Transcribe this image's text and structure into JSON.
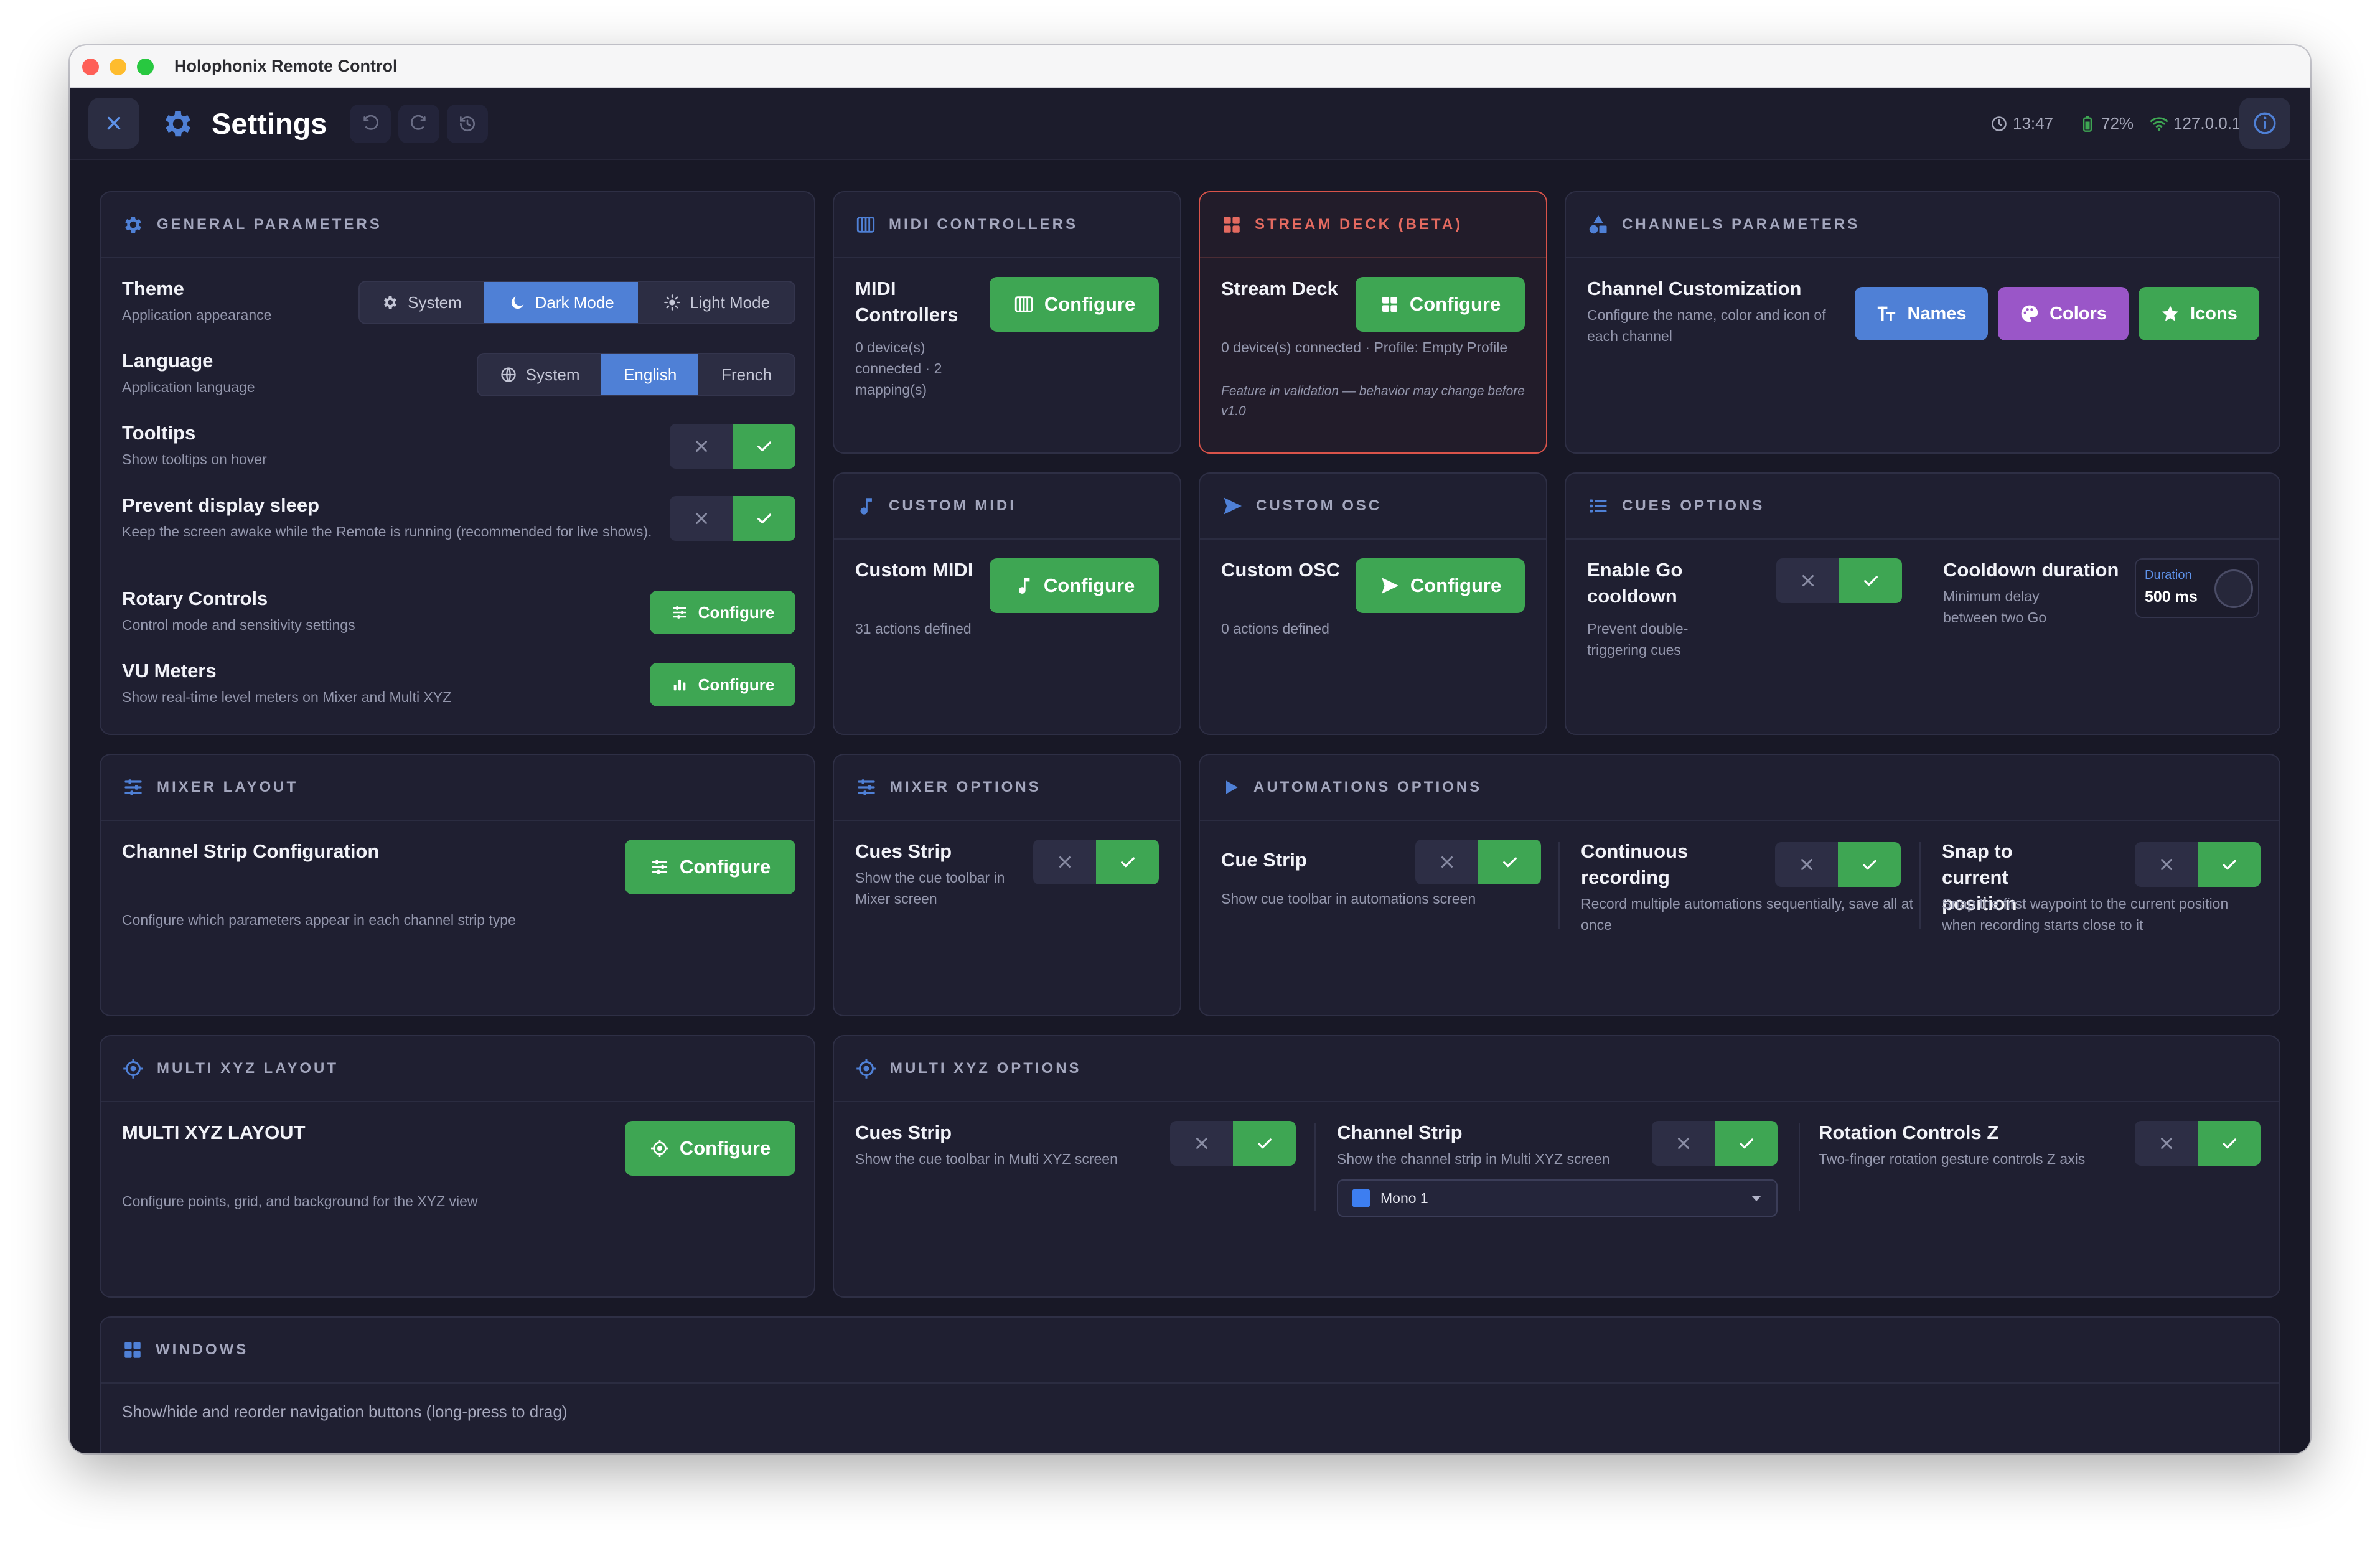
{
  "window": {
    "title": "Holophonix Remote Control"
  },
  "header": {
    "title": "Settings",
    "time": "13:47",
    "battery": "72%",
    "ip": "127.0.0.1"
  },
  "general": {
    "title": "GENERAL PARAMETERS",
    "theme": {
      "label": "Theme",
      "desc": "Application appearance",
      "options": [
        "System",
        "Dark Mode",
        "Light Mode"
      ],
      "selected": "Dark Mode"
    },
    "language": {
      "label": "Language",
      "desc": "Application language",
      "options": [
        "System",
        "English",
        "French"
      ],
      "selected": "English"
    },
    "tooltips": {
      "label": "Tooltips",
      "desc": "Show tooltips on hover",
      "enabled": true
    },
    "sleep": {
      "label": "Prevent display sleep",
      "desc": "Keep the screen awake while the Remote is running (recommended for live shows).",
      "enabled": true
    },
    "rotary": {
      "label": "Rotary Controls",
      "desc": "Control mode and sensitivity settings",
      "button": "Configure"
    },
    "vu": {
      "label": "VU Meters",
      "desc": "Show real-time level meters on Mixer and Multi XYZ",
      "button": "Configure"
    }
  },
  "midi": {
    "title": "MIDI CONTROLLERS",
    "label": "MIDI Controllers",
    "desc": "0 device(s) connected · 2 mapping(s)",
    "button": "Configure"
  },
  "streamdeck": {
    "title": "STREAM DECK (BETA)",
    "label": "Stream Deck",
    "desc": "0 device(s) connected · Profile: Empty Profile",
    "note": "Feature in validation — behavior may change before v1.0",
    "button": "Configure"
  },
  "channels": {
    "title": "CHANNELS PARAMETERS",
    "label": "Channel Customization",
    "desc": "Configure the name, color and icon of each channel",
    "buttons": {
      "names": "Names",
      "colors": "Colors",
      "icons": "Icons"
    }
  },
  "custom_midi": {
    "title": "CUSTOM MIDI",
    "label": "Custom MIDI",
    "desc": "31 actions defined",
    "button": "Configure"
  },
  "custom_osc": {
    "title": "CUSTOM OSC",
    "label": "Custom OSC",
    "desc": "0 actions defined",
    "button": "Configure"
  },
  "cues": {
    "title": "CUES OPTIONS",
    "go": {
      "label": "Enable Go cooldown",
      "desc": "Prevent double-triggering cues",
      "enabled": true
    },
    "cooldown": {
      "label": "Cooldown duration",
      "desc": "Minimum delay between two Go",
      "dial_label": "Duration",
      "dial_value": "500 ms"
    }
  },
  "mixer_layout": {
    "title": "MIXER LAYOUT",
    "label": "Channel Strip Configuration",
    "desc": "Configure which parameters appear in each channel strip type",
    "button": "Configure"
  },
  "mixer_options": {
    "title": "MIXER OPTIONS",
    "label": "Cues Strip",
    "desc": "Show the cue toolbar in Mixer screen",
    "enabled": true
  },
  "automations": {
    "title": "AUTOMATIONS OPTIONS",
    "cue_strip": {
      "label": "Cue Strip",
      "desc": "Show cue toolbar in automations screen",
      "enabled": true
    },
    "continuous": {
      "label": "Continuous recording",
      "desc": "Record multiple automations sequentially, save all at once",
      "enabled": true
    },
    "snap": {
      "label": "Snap to current position",
      "desc": "Snap the first waypoint to the current position when recording starts close to it",
      "enabled": true
    }
  },
  "xyz_layout": {
    "title": "MULTI XYZ LAYOUT",
    "label": "MULTI XYZ LAYOUT",
    "desc": "Configure points, grid, and background for the XYZ view",
    "button": "Configure"
  },
  "xyz_options": {
    "title": "MULTI XYZ OPTIONS",
    "cues": {
      "label": "Cues Strip",
      "desc": "Show the cue toolbar in Multi XYZ screen",
      "enabled": true
    },
    "channel": {
      "label": "Channel Strip",
      "desc": "Show the channel strip in Multi XYZ screen",
      "enabled": true,
      "select_value": "Mono 1",
      "select_color": "#3d7ef0"
    },
    "rotation": {
      "label": "Rotation Controls Z",
      "desc": "Two-finger rotation gesture controls Z axis",
      "enabled": true
    }
  },
  "windows": {
    "title": "WINDOWS",
    "desc": "Show/hide and reorder navigation buttons (long-press to drag)",
    "tab_colors": [
      "#c0444a",
      "#8a54b6",
      "#3f9a62",
      "#4f7ed2",
      "#d5783c",
      "#4aa2d8"
    ]
  },
  "colors": {
    "accent_green": "#3ea653",
    "accent_blue": "#4f80d6",
    "accent_purple": "#9a56c8",
    "warning_red": "#d9534a"
  }
}
